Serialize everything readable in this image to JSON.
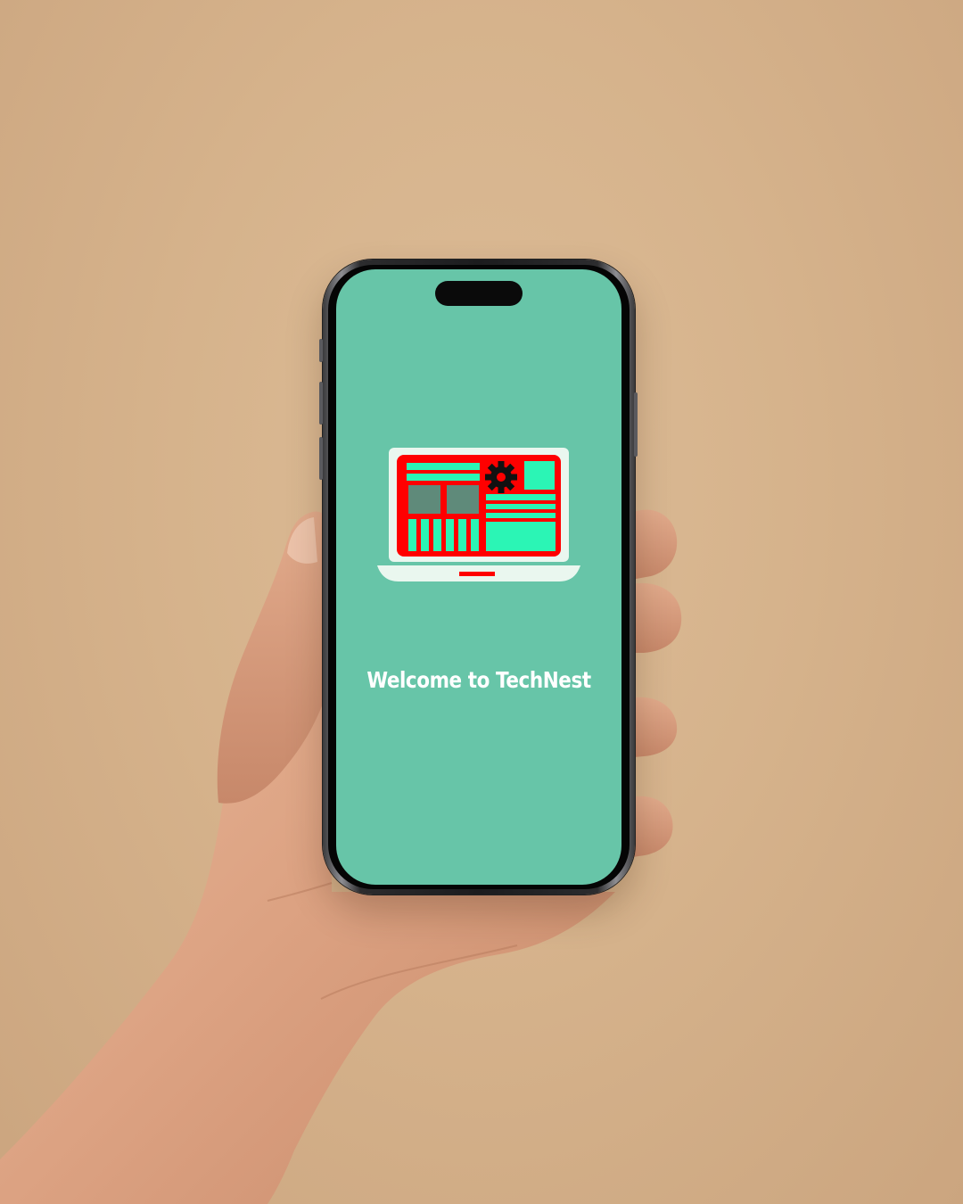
{
  "background_color": "#d6b38c",
  "device": {
    "type": "smartphone",
    "screen_color": "#67c5a8",
    "frame_color": "#1c1c1e"
  },
  "app": {
    "logo_icon": "laptop-dashboard-icon",
    "logo_colors": {
      "frame": "#eaf7ef",
      "panel": "#ff0000",
      "tiles": "#2bf5b5",
      "dark_tiles": "#5f8a7a",
      "gear": "#111111"
    },
    "welcome_text": "Welcome to TechNest"
  }
}
